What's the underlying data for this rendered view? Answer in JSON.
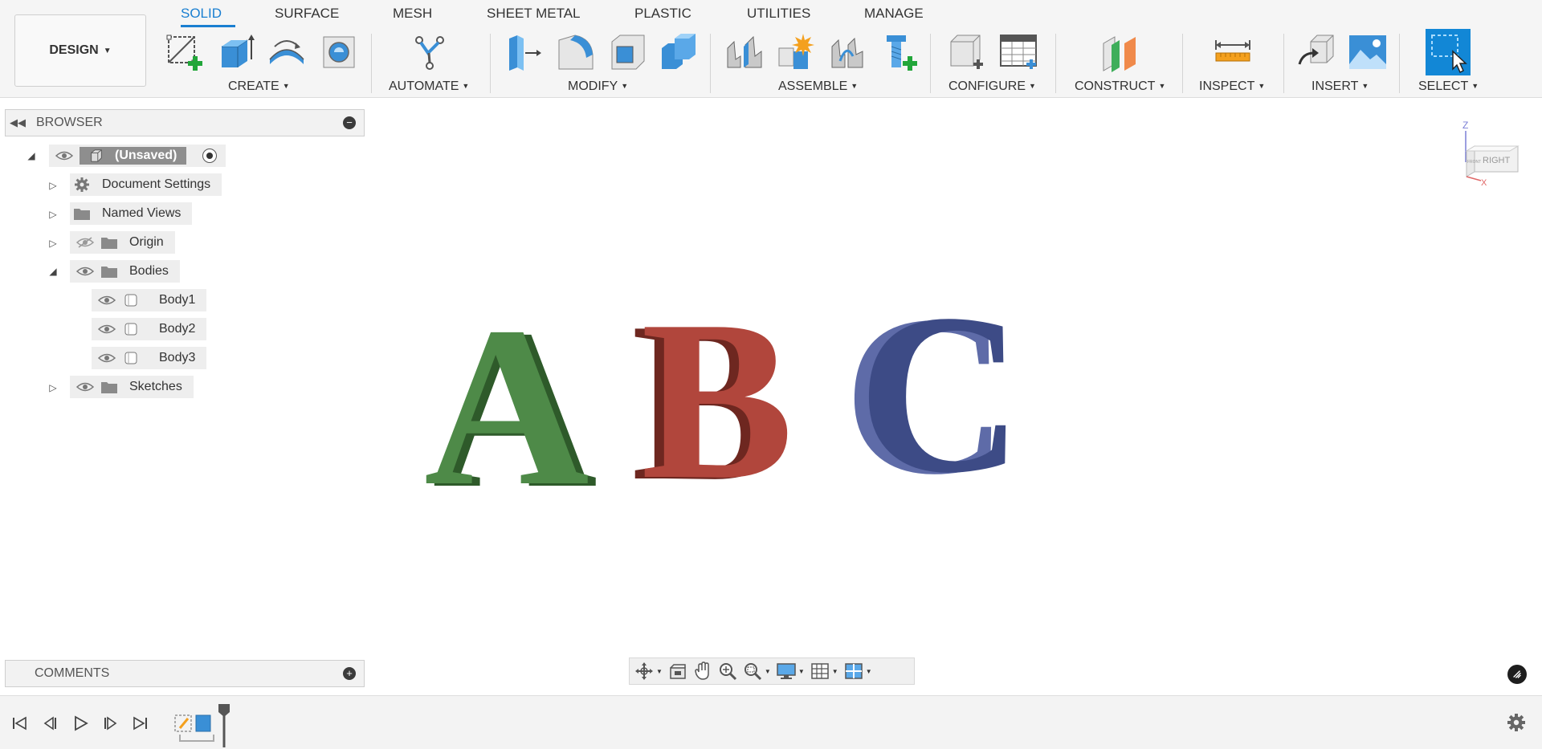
{
  "workspace": {
    "label": "DESIGN"
  },
  "tabs": [
    {
      "label": "SOLID",
      "active": true
    },
    {
      "label": "SURFACE"
    },
    {
      "label": "MESH"
    },
    {
      "label": "SHEET METAL"
    },
    {
      "label": "PLASTIC"
    },
    {
      "label": "UTILITIES"
    },
    {
      "label": "MANAGE"
    }
  ],
  "groups": {
    "create": "CREATE",
    "automate": "AUTOMATE",
    "modify": "MODIFY",
    "assemble": "ASSEMBLE",
    "configure": "CONFIGURE",
    "construct": "CONSTRUCT",
    "inspect": "INSPECT",
    "insert": "INSERT",
    "select": "SELECT"
  },
  "browser": {
    "title": "BROWSER",
    "root": "(Unsaved)",
    "items": {
      "document_settings": "Document Settings",
      "named_views": "Named Views",
      "origin": "Origin",
      "bodies": "Bodies",
      "body1": "Body1",
      "body2": "Body2",
      "body3": "Body3",
      "sketches": "Sketches"
    }
  },
  "viewport": {
    "letters": [
      "A",
      "B",
      "C"
    ],
    "letter_colors": [
      "#4e8a48",
      "#b1463c",
      "#3d4b86"
    ],
    "viewcube": {
      "face": "RIGHT",
      "side": "FRONT",
      "axis_z": "Z",
      "axis_x": "X"
    }
  },
  "comments": {
    "title": "COMMENTS"
  },
  "colors": {
    "accent": "#1a7fd1",
    "ribbon_bg": "#f5f5f5"
  }
}
